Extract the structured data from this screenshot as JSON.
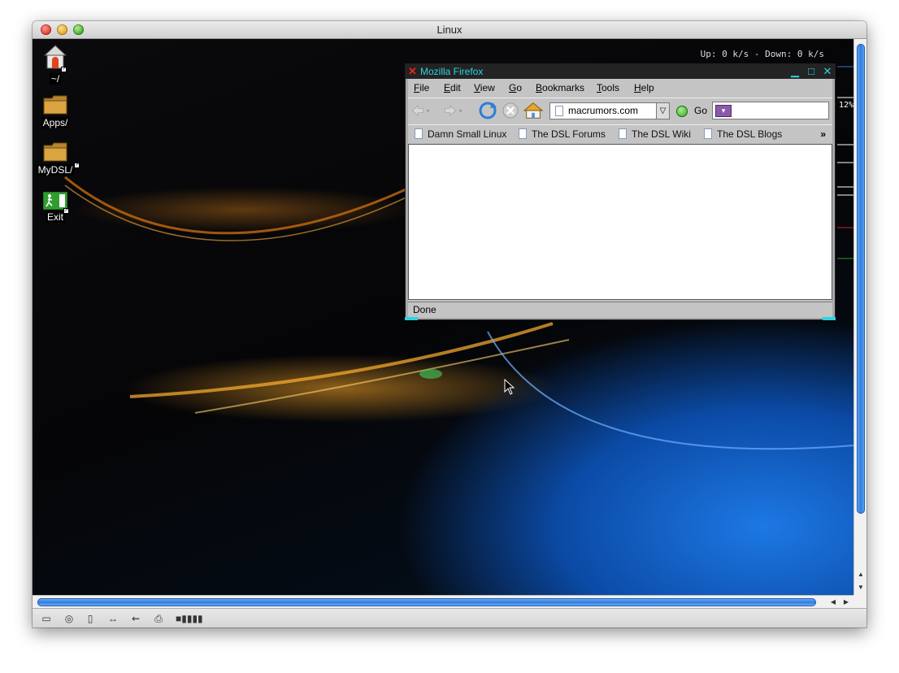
{
  "host_window": {
    "title": "Linux"
  },
  "desktop": {
    "net_status": "Up: 0 k/s - Down: 0 k/s",
    "right_widget_percent": "12%",
    "icons": [
      {
        "label": "~/",
        "icon": "home-icon"
      },
      {
        "label": "Apps/",
        "icon": "folder-icon"
      },
      {
        "label": "MyDSL/",
        "icon": "folder-icon"
      },
      {
        "label": "Exit",
        "icon": "exit-icon"
      }
    ]
  },
  "firefox": {
    "title": "Mozilla Firefox",
    "menu": [
      "File",
      "Edit",
      "View",
      "Go",
      "Bookmarks",
      "Tools",
      "Help"
    ],
    "menu_accel": [
      "F",
      "E",
      "V",
      "G",
      "B",
      "T",
      "H"
    ],
    "url": "macrumors.com",
    "go_label": "Go",
    "search_value": "",
    "bookmarks": [
      "Damn Small Linux",
      "The DSL Forums",
      "The DSL Wiki",
      "The DSL Blogs"
    ],
    "bookmarks_overflow": "»",
    "status": "Done"
  },
  "colors": {
    "firefox_title_text": "#2dd3e6",
    "firefox_close_x": "#e8261a",
    "scroll_thumb": "#2f7ee0"
  }
}
